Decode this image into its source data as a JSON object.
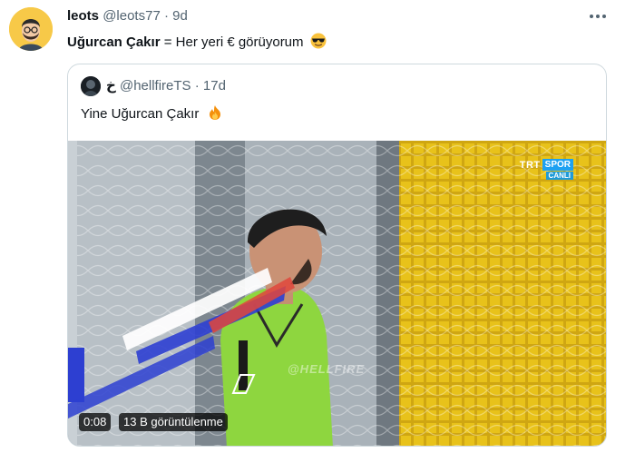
{
  "tweet": {
    "author_name": "leots",
    "author_handle": "@leots77",
    "separator": "·",
    "time": "9d",
    "text_bold": "Uğurcan Çakır",
    "text_rest": " = Her yeri € görüyorum",
    "emoji": "sunglasses-emoji"
  },
  "quoted": {
    "author_name": "خ",
    "author_handle": "@hellfireTS",
    "separator": "·",
    "time": "17d",
    "text": "Yine Uğurcan Çakır",
    "emoji": "fire-emoji",
    "video": {
      "channel": "TRT",
      "channel_tag": "SPOR",
      "live_label": "CANLI",
      "watermark": "@HELLFIRE",
      "duration": "0:08",
      "views": "13 B görüntülenme"
    }
  },
  "colors": {
    "text": "#0f1419",
    "secondary": "#536471",
    "border": "#cfd9de",
    "jersey": "#8ed63f",
    "net_yellow": "#e8c21a"
  }
}
